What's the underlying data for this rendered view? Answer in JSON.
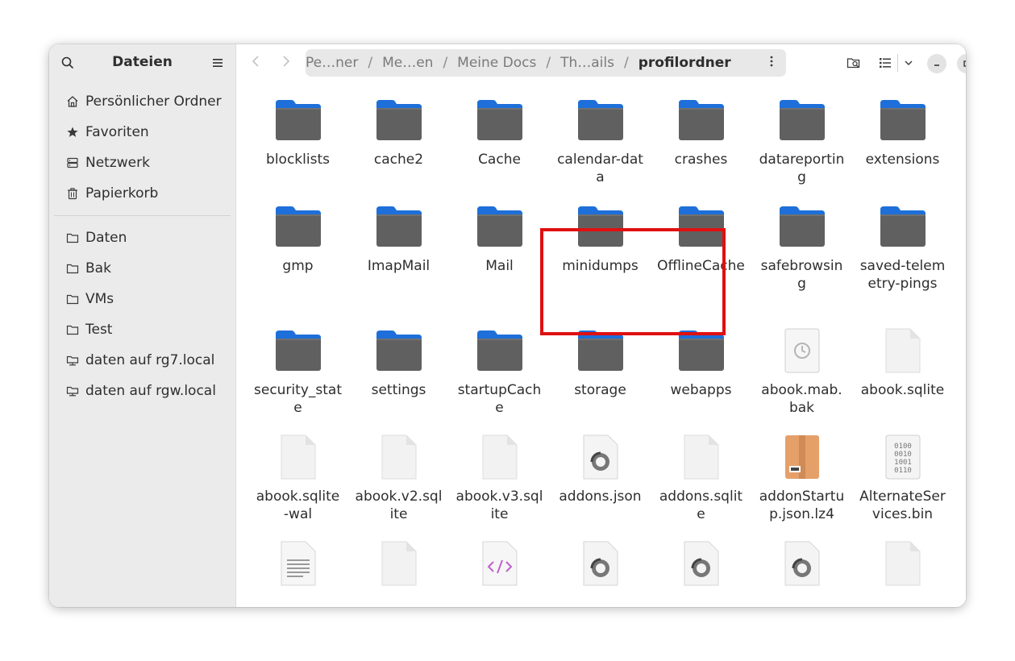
{
  "sidebar": {
    "title": "Dateien",
    "items": [
      {
        "label": "Persönlicher Ordner",
        "icon": "home-icon"
      },
      {
        "label": "Favoriten",
        "icon": "star-icon"
      },
      {
        "label": "Netzwerk",
        "icon": "network-icon"
      },
      {
        "label": "Papierkorb",
        "icon": "trash-icon"
      }
    ],
    "bookmarks": [
      {
        "label": "Daten",
        "icon": "folder-icon"
      },
      {
        "label": "Bak",
        "icon": "folder-icon"
      },
      {
        "label": "VMs",
        "icon": "folder-icon"
      },
      {
        "label": "Test",
        "icon": "folder-icon"
      },
      {
        "label": "daten auf rg7.local",
        "icon": "network-folder-icon"
      },
      {
        "label": "daten auf rgw.local",
        "icon": "network-folder-icon"
      }
    ]
  },
  "header": {
    "path": [
      "Pe…ner",
      "Me…en",
      "Meine Docs",
      "Th…ails"
    ],
    "current": "profilordner",
    "separator": "/"
  },
  "files": [
    {
      "name": "blocklists",
      "type": "folder"
    },
    {
      "name": "cache2",
      "type": "folder"
    },
    {
      "name": "Cache",
      "type": "folder"
    },
    {
      "name": "calendar-data",
      "type": "folder"
    },
    {
      "name": "crashes",
      "type": "folder"
    },
    {
      "name": "datareporting",
      "type": "folder"
    },
    {
      "name": "extensions",
      "type": "folder"
    },
    {
      "name": "gmp",
      "type": "folder"
    },
    {
      "name": "ImapMail",
      "type": "folder"
    },
    {
      "name": "Mail",
      "type": "folder"
    },
    {
      "name": "minidumps",
      "type": "folder"
    },
    {
      "name": "OfflineCache",
      "type": "folder"
    },
    {
      "name": "safebrowsing",
      "type": "folder"
    },
    {
      "name": "saved-telemetry-pings",
      "type": "folder"
    },
    {
      "name": "security_state",
      "type": "folder"
    },
    {
      "name": "settings",
      "type": "folder"
    },
    {
      "name": "startupCache",
      "type": "folder"
    },
    {
      "name": "storage",
      "type": "folder"
    },
    {
      "name": "webapps",
      "type": "folder"
    },
    {
      "name": "abook.mab.bak",
      "type": "backup"
    },
    {
      "name": "abook.sqlite",
      "type": "file"
    },
    {
      "name": "abook.sqlite-wal",
      "type": "file"
    },
    {
      "name": "abook.v2.sqlite",
      "type": "file"
    },
    {
      "name": "abook.v3.sqlite",
      "type": "file"
    },
    {
      "name": "addons.json",
      "type": "json"
    },
    {
      "name": "addons.sqlite",
      "type": "file"
    },
    {
      "name": "addonStartup.json.lz4",
      "type": "archive"
    },
    {
      "name": "AlternateServices.bin",
      "type": "binary"
    },
    {
      "name": "",
      "type": "text"
    },
    {
      "name": "",
      "type": "file"
    },
    {
      "name": "",
      "type": "html"
    },
    {
      "name": "",
      "type": "json"
    },
    {
      "name": "",
      "type": "json"
    },
    {
      "name": "",
      "type": "json"
    },
    {
      "name": "",
      "type": "file"
    }
  ],
  "colors": {
    "highlight": "#e01010",
    "folder_tab": "#1e6fd9",
    "folder_body": "#606060",
    "sidebar_bg": "#ebebeb"
  }
}
